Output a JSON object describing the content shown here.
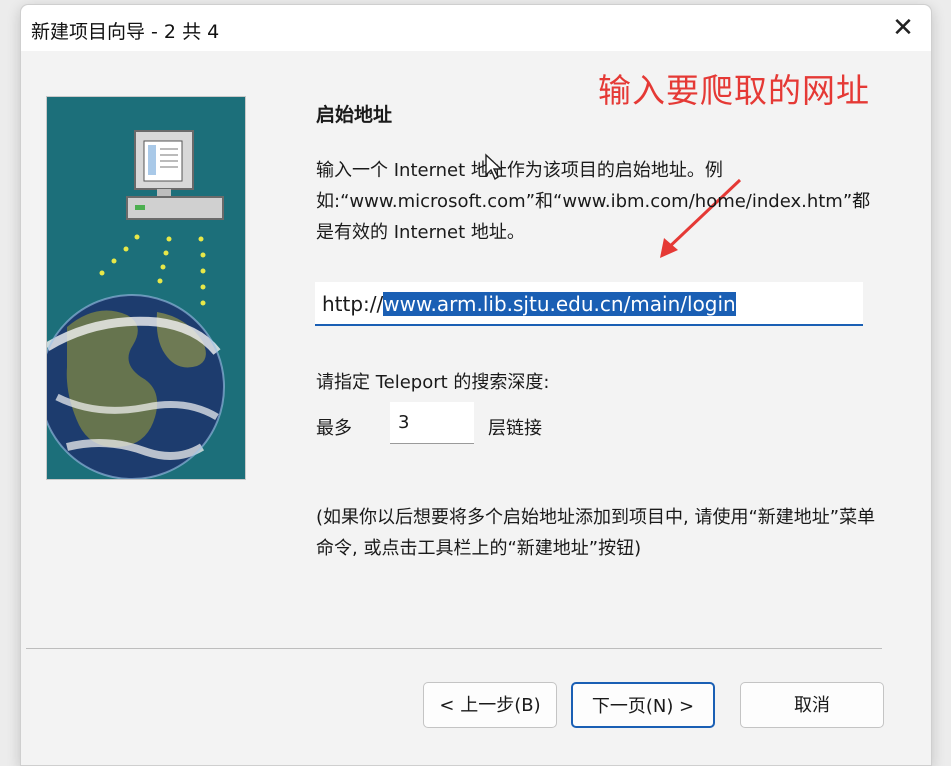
{
  "window": {
    "title": "新建项目向导 - 2 共 4",
    "close_glyph": "✕"
  },
  "annotation": {
    "text": "输入要爬取的网址",
    "color": "#e53935"
  },
  "content": {
    "heading": "启始地址",
    "description": "输入一个 Internet 地址作为该项目的启始地址。例如:“www.microsoft.com”和“www.ibm.com/home/index.htm”都是有效的 Internet 地址。",
    "url": {
      "prefix": "http://",
      "selected": "www.arm.lib.sjtu.edu.cn/main/login"
    },
    "depth_prompt": "请指定 Teleport 的搜索深度:",
    "most_label": "最多",
    "depth_value": "3",
    "levels_label": "层链接",
    "note": "(如果你以后想要将多个启始地址添加到项目中, 请使用“新建地址”菜单命令, 或点击工具栏上的“新建地址”按钮)"
  },
  "buttons": {
    "back": "< 上一步(B)",
    "next": "下一页(N) >",
    "cancel": "取消"
  },
  "icons": {
    "computer": "computer-icon",
    "globe": "globe-icon",
    "cursor": "mouse-cursor-icon",
    "arrow": "annotation-arrow"
  },
  "colors": {
    "accent": "#1a5fb4",
    "side_panel": "#1c6f7a",
    "annotation": "#e53935"
  }
}
